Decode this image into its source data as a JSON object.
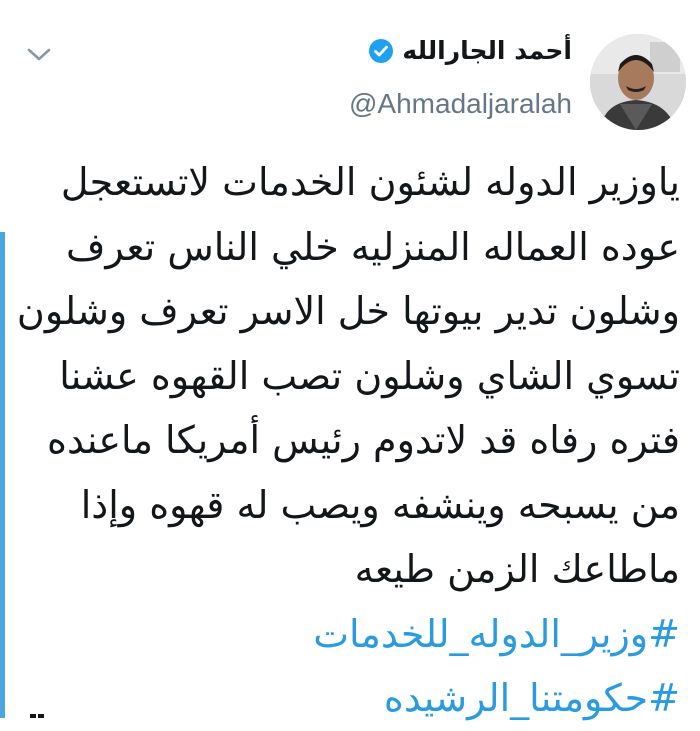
{
  "author": {
    "display_name": "أحمد الجارالله",
    "handle": "@Ahmadaljaralah",
    "verified_icon": "verified-badge-icon",
    "avatar": "profile-photo"
  },
  "menu": {
    "icon": "chevron-down-icon"
  },
  "tweet": {
    "lines": [
      "ياوزير الدوله لشئون الخدمات لاتستعجل",
      "عوده العماله المنزليه خلي الناس تعرف",
      "وشلون تدير بيوتها خل الاسر تعرف وشلون",
      "تسوي الشاي وشلون تصب القهوه عشنا",
      "فتره رفاه قد لاتدوم رئيس أمريكا ماعنده",
      "من يسبحه وينشفه ويصب له قهوه وإذا",
      "ماطاعك الزمن طيعه"
    ],
    "hashtags": [
      "#وزير_الدوله_للخدمات",
      "#حكومتنا_الرشيده"
    ]
  },
  "colors": {
    "text": "#14171a",
    "secondary": "#657786",
    "link": "#2b9be0",
    "verified": "#1da1f2",
    "rail": "#4aa6e0"
  }
}
